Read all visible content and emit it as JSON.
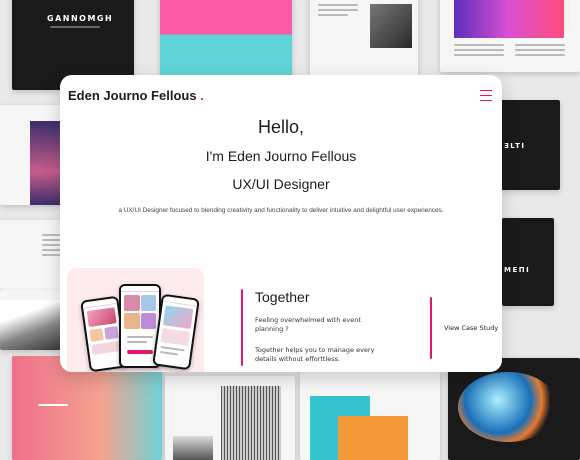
{
  "background": {
    "cover_title": "GANNOMGH",
    "right_cover_title": "ƎLTI",
    "right_cover_title_2": "MEΠI"
  },
  "header": {
    "brand_name": "Eden Journo Fellous",
    "brand_dot": ".",
    "menu_icon": "hamburger-menu-icon",
    "accent_color": "#e9156e"
  },
  "hero": {
    "greeting": "Hello,",
    "intro": "I'm Eden Journo Fellous",
    "role": "UX/UI Designer",
    "tagline": "a UX/UI Designer focused to blending creativity and functionality to deliver intuitive and delightful user experiences."
  },
  "case_study": {
    "title": "Together",
    "question": "Feeling overwhelmed with event planning ?",
    "description": "Together helps you to manage every details without efforttless.",
    "link_label": "View Case Study",
    "image_bg_color": "#fdebee"
  }
}
